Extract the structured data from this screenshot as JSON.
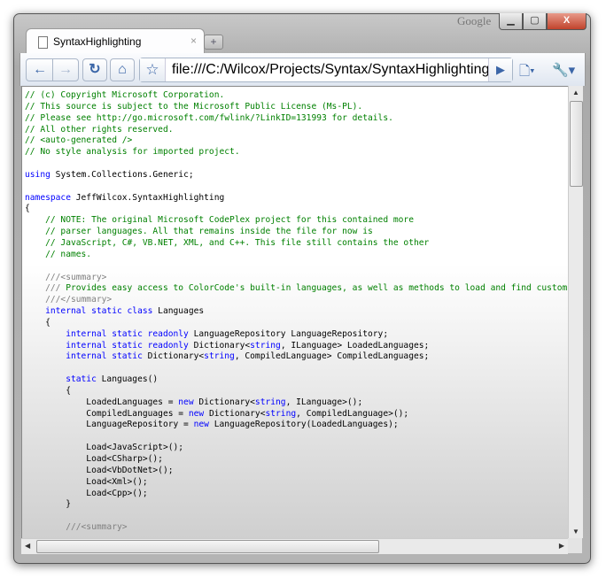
{
  "window": {
    "brand": "Google",
    "minimize": "▁",
    "maximize": "▢",
    "close": "X"
  },
  "tab": {
    "title": "SyntaxHighlighting",
    "close": "×",
    "new_tab": "+"
  },
  "toolbar": {
    "back": "←",
    "forward": "→",
    "reload": "↻",
    "home": "⌂",
    "bookmark_star": "☆",
    "url": "file:///C:/Wilcox/Projects/Syntax/SyntaxHighlighting/",
    "go": "▶",
    "page_menu": "🗋▾",
    "wrench_menu": "🔧▾"
  },
  "code_lines": [
    [
      [
        "cm",
        "// (c) Copyright Microsoft Corporation."
      ]
    ],
    [
      [
        "cm",
        "// This source is subject to the Microsoft Public License (Ms-PL)."
      ]
    ],
    [
      [
        "cm",
        "// Please see http://go.microsoft.com/fwlink/?LinkID=131993 for details."
      ]
    ],
    [
      [
        "cm",
        "// All other rights reserved."
      ]
    ],
    [
      [
        "cm",
        "// <auto-generated />"
      ]
    ],
    [
      [
        "cm",
        "// No style analysis for imported project."
      ]
    ],
    [],
    [
      [
        "kw",
        "using"
      ],
      [
        "",
        "System.Collections.Generic;"
      ]
    ],
    [],
    [
      [
        "kw",
        "namespace"
      ],
      [
        "",
        "JeffWilcox.SyntaxHighlighting"
      ]
    ],
    [
      [
        "",
        "{"
      ]
    ],
    [
      [
        "cm",
        "    // NOTE: The original Microsoft CodePlex project for this contained more"
      ]
    ],
    [
      [
        "cm",
        "    // parser languages. All that remains inside the file for now is"
      ]
    ],
    [
      [
        "cm",
        "    // JavaScript, C#, VB.NET, XML, and C++. This file still contains the other"
      ]
    ],
    [
      [
        "cm",
        "    // names."
      ]
    ],
    [],
    [
      [
        "xd",
        "    ///<summary>"
      ]
    ],
    [
      [
        "xd",
        "    ///"
      ],
      [
        "cm",
        " Provides easy access to ColorCode's built-in languages, as well as methods to load and find custom languages."
      ]
    ],
    [
      [
        "xd",
        "    ///</summary>"
      ]
    ],
    [
      [
        "kw",
        "    internal static class"
      ],
      [
        "",
        "Languages"
      ]
    ],
    [
      [
        "",
        "    {"
      ]
    ],
    [
      [
        "kw",
        "        internal static readonly"
      ],
      [
        "",
        "LanguageRepository LanguageRepository;"
      ]
    ],
    [
      [
        "kw",
        "        internal static readonly"
      ],
      [
        "",
        "Dictionary<"
      ],
      [
        "kw",
        "string"
      ],
      [
        "",
        ", ILanguage> LoadedLanguages;"
      ]
    ],
    [
      [
        "kw",
        "        internal static"
      ],
      [
        "",
        "Dictionary<"
      ],
      [
        "kw",
        "string"
      ],
      [
        "",
        ", CompiledLanguage> CompiledLanguages;"
      ]
    ],
    [],
    [
      [
        "kw",
        "        static"
      ],
      [
        "",
        "Languages()"
      ]
    ],
    [
      [
        "",
        "        {"
      ]
    ],
    [
      [
        "",
        "            LoadedLanguages = "
      ],
      [
        "kw",
        "new"
      ],
      [
        "",
        "Dictionary<"
      ],
      [
        "kw",
        "string"
      ],
      [
        "",
        ", ILanguage>();"
      ]
    ],
    [
      [
        "",
        "            CompiledLanguages = "
      ],
      [
        "kw",
        "new"
      ],
      [
        "",
        "Dictionary<"
      ],
      [
        "kw",
        "string"
      ],
      [
        "",
        ", CompiledLanguage>();"
      ]
    ],
    [
      [
        "",
        "            LanguageRepository = "
      ],
      [
        "kw",
        "new"
      ],
      [
        "",
        "LanguageRepository(LoadedLanguages);"
      ]
    ],
    [],
    [
      [
        "",
        "            Load<JavaScript>();"
      ]
    ],
    [
      [
        "",
        "            Load<CSharp>();"
      ]
    ],
    [
      [
        "",
        "            Load<VbDotNet>();"
      ]
    ],
    [
      [
        "",
        "            Load<Xml>();"
      ]
    ],
    [
      [
        "",
        "            Load<Cpp>();"
      ]
    ],
    [
      [
        "",
        "        }"
      ]
    ],
    [],
    [
      [
        "xd",
        "        ///<summary>"
      ]
    ]
  ],
  "scrollbars": {
    "up": "▲",
    "down": "▼",
    "left": "◀",
    "right": "▶"
  }
}
